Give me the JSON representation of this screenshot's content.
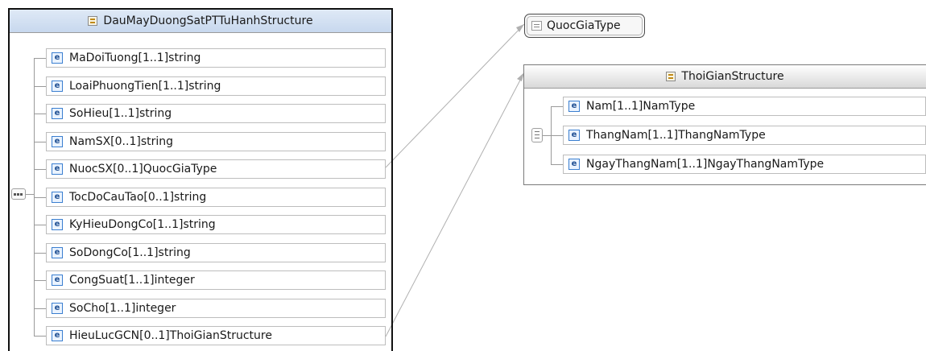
{
  "main_structure": {
    "title": "DauMayDuongSatPTTuHanhStructure",
    "elements": [
      {
        "name": "MaDoiTuong",
        "cardinality": "[1..1]",
        "type": "string"
      },
      {
        "name": "LoaiPhuongTien",
        "cardinality": "[1..1]",
        "type": "string"
      },
      {
        "name": "SoHieu",
        "cardinality": "[1..1]",
        "type": "string"
      },
      {
        "name": "NamSX",
        "cardinality": "[0..1]",
        "type": "string"
      },
      {
        "name": "NuocSX",
        "cardinality": "[0..1]",
        "type": "QuocGiaType"
      },
      {
        "name": "TocDoCauTao",
        "cardinality": "[0..1]",
        "type": "string"
      },
      {
        "name": "KyHieuDongCo",
        "cardinality": "[1..1]",
        "type": "string"
      },
      {
        "name": "SoDongCo",
        "cardinality": "[1..1]",
        "type": "string"
      },
      {
        "name": "CongSuat",
        "cardinality": "[1..1]",
        "type": "integer"
      },
      {
        "name": "SoCho",
        "cardinality": "[1..1]",
        "type": "integer"
      },
      {
        "name": "HieuLucGCN",
        "cardinality": "[0..1]",
        "type": "ThoiGianStructure"
      }
    ]
  },
  "simple_type": {
    "title": "QuocGiaType"
  },
  "time_structure": {
    "title": "ThoiGianStructure",
    "elements": [
      {
        "name": "Nam",
        "cardinality": "[1..1]",
        "type": "NamType"
      },
      {
        "name": "ThangNam",
        "cardinality": "[1..1]",
        "type": "ThangNamType"
      },
      {
        "name": "NgayThangNam",
        "cardinality": "[1..1]",
        "type": "NgayThangNamType"
      }
    ]
  },
  "icons": {
    "element_icon": "element-icon",
    "structure_icon": "complex-type-icon",
    "simple_type_icon": "simple-type-icon",
    "sequence_icon": "sequence-icon",
    "choice_icon": "choice-icon",
    "element_icon_letter": "e"
  },
  "colors": {
    "main_header": "#c7d8ee",
    "time_header": "#d8d8d8",
    "element_icon_border": "#3b7fd0",
    "connector": "#b0b0b0"
  }
}
